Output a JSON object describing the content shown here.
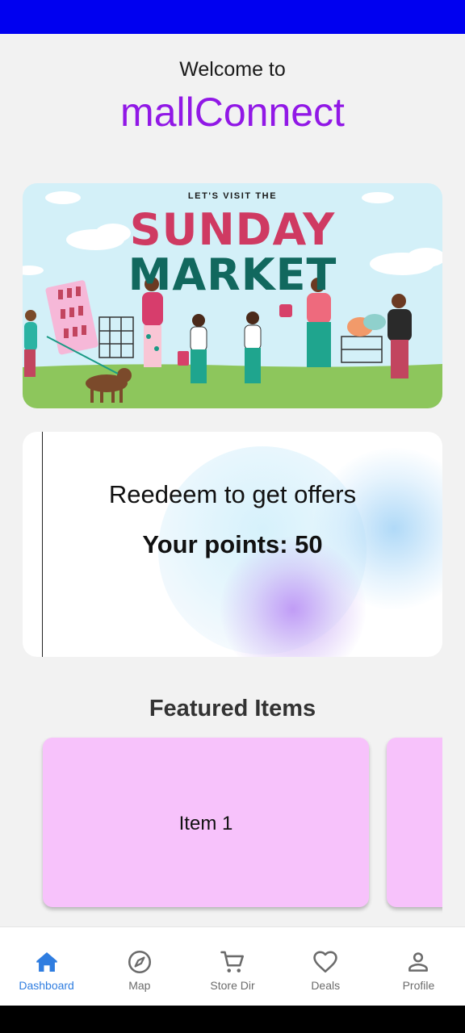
{
  "header": {
    "welcome": "Welcome to",
    "app_name": "mallConnect"
  },
  "banner": {
    "kicker": "LET'S VISIT THE",
    "title_line1": "SUNDAY",
    "title_line2": "MARKET"
  },
  "rewards": {
    "headline": "Reedeem to get offers",
    "points_text": "Your points: 50"
  },
  "featured": {
    "title": "Featured Items",
    "items": [
      {
        "label": "Item 1"
      },
      {
        "label": ""
      }
    ]
  },
  "nav": {
    "items": [
      {
        "label": "Dashboard",
        "icon": "home-icon",
        "active": true
      },
      {
        "label": "Map",
        "icon": "compass-icon",
        "active": false
      },
      {
        "label": "Store Dir",
        "icon": "cart-icon",
        "active": false
      },
      {
        "label": "Deals",
        "icon": "heart-icon",
        "active": false
      },
      {
        "label": "Profile",
        "icon": "person-icon",
        "active": false
      }
    ]
  },
  "colors": {
    "status_bar": "#0000f0",
    "brand": "#9118e6",
    "card_pink": "#f7c2fb",
    "nav_active": "#2f7de0",
    "nav_inactive": "#6b6b6b"
  }
}
